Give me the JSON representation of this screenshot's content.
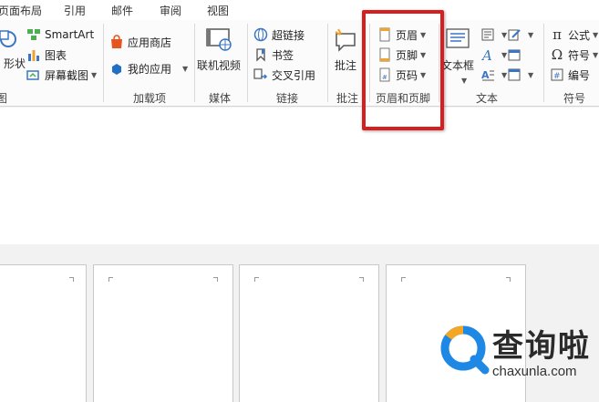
{
  "tabs": [
    "页面布局",
    "引用",
    "邮件",
    "审阅",
    "视图"
  ],
  "ribbon": {
    "illustrations": {
      "shape_label": "形状",
      "smartart_label": "SmartArt",
      "chart_label": "图表",
      "screenshot_label": "屏幕截图",
      "group_label": "图"
    },
    "addins": {
      "store_label": "应用商店",
      "myapps_label": "我的应用",
      "group_label": "加载项"
    },
    "media": {
      "video_label": "联机视频",
      "group_label": "媒体"
    },
    "links": {
      "hyperlink_label": "超链接",
      "bookmark_label": "书签",
      "crossref_label": "交叉引用",
      "group_label": "链接"
    },
    "comments": {
      "comment_label": "批注",
      "group_label": "批注"
    },
    "header_footer": {
      "header_label": "页眉",
      "footer_label": "页脚",
      "pagenum_label": "页码",
      "group_label": "页眉和页脚"
    },
    "text": {
      "textbox_label": "文本框",
      "group_label": "文本"
    },
    "symbols": {
      "equation_label": "公式",
      "symbol_label": "符号",
      "numbering_label": "编号",
      "group_label": "符号"
    }
  },
  "watermark": {
    "title": "查询啦",
    "url": "chaxunla.com"
  },
  "colors": {
    "highlight": "#d61f1f",
    "watermark_blue": "#1e88e5",
    "watermark_orange": "#f5a623"
  }
}
